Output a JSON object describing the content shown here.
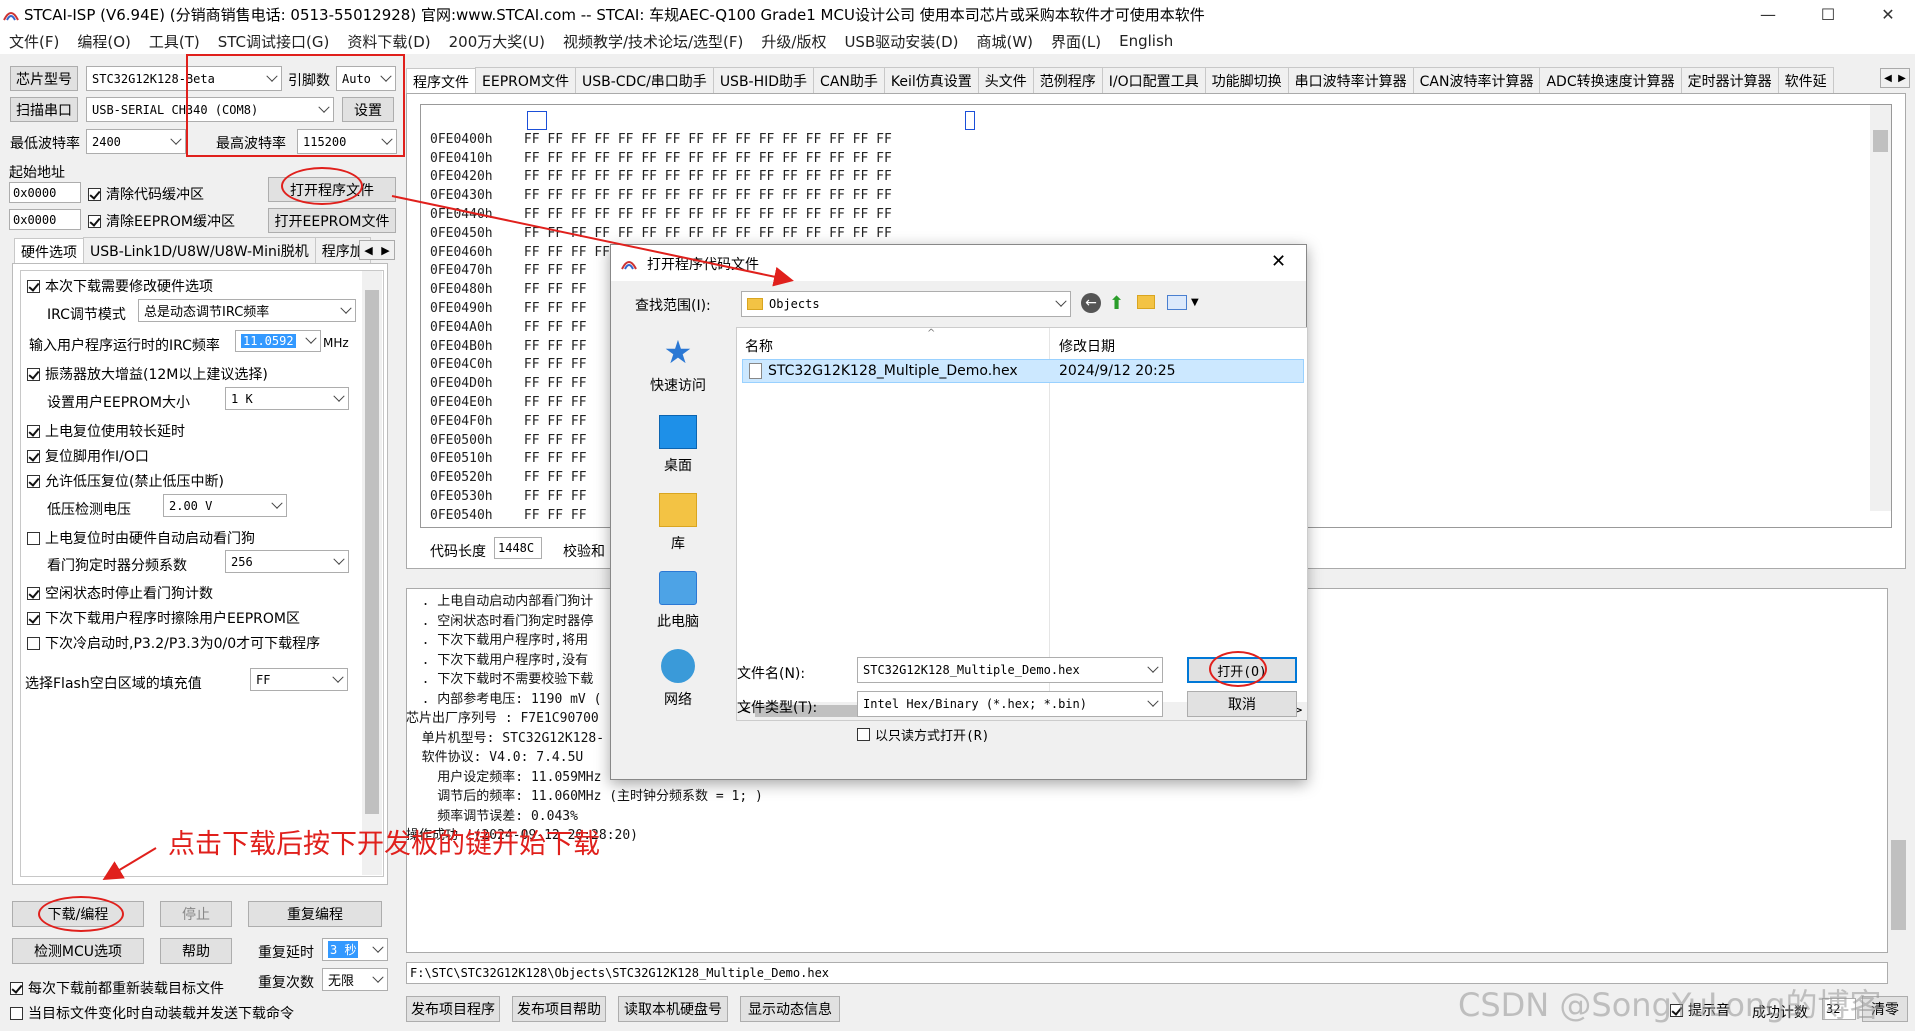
{
  "window": {
    "title": "STCAI-ISP (V6.94E) (分销商销售电话: 0513-55012928) 官网:www.STCAI.com  -- STCAI: 车规AEC-Q100 Grade1 MCU设计公司 使用本司芯片或采购本软件才可使用本软件",
    "min": "—",
    "max": "☐",
    "close": "✕"
  },
  "menu": [
    "文件(F)",
    "编程(O)",
    "工具(T)",
    "STC调试接口(G)",
    "资料下载(D)",
    "200万大奖(U)",
    "视频教学/技术论坛/选型(F)",
    "升级/版权",
    "USB驱动安装(D)",
    "商城(W)",
    "界面(L)",
    "English"
  ],
  "left": {
    "chip_type_btn": "芯片型号",
    "chip_type": "STC32G12K128-Beta",
    "pin_count_label": "引脚数",
    "pin_count": "Auto",
    "scan_port_btn": "扫描串口",
    "port": "USB-SERIAL CH340 (COM8)",
    "settings_btn": "设置",
    "min_baud_label": "最低波特率",
    "min_baud": "2400",
    "max_baud_label": "最高波特率",
    "max_baud": "115200",
    "start_addr_label": "起始地址",
    "addr1": "0x0000",
    "clear_code_buf": "清除代码缓冲区",
    "open_program_btn": "打开程序文件",
    "addr2": "0x0000",
    "clear_eeprom_buf": "清除EEPROM缓冲区",
    "open_eeprom_btn": "打开EEPROM文件",
    "tabs": [
      "硬件选项",
      "USB-Link1D/U8W/U8W-Mini脱机",
      "程序加"
    ],
    "hw": {
      "modify_hw": "本次下载需要修改硬件选项",
      "irc_mode_label": "IRC调节模式",
      "irc_mode": "总是动态调节IRC频率",
      "irc_freq_label": "输入用户程序运行时的IRC频率",
      "irc_freq": "11.0592",
      "mhz": "MHz",
      "osc_gain": "振荡器放大增益(12M以上建议选择)",
      "eeprom_size_label": "设置用户EEPROM大小",
      "eeprom_size": "1    K",
      "long_delay": "上电复位使用较长延时",
      "reset_io": "复位脚用作I/O口",
      "lvr": "允许低压复位(禁止低压中断)",
      "lvd_label": "低压检测电压",
      "lvd": "2.00 V",
      "wdt_auto": "上电复位时由硬件自动启动看门狗",
      "wdt_div_label": "看门狗定时器分频系数",
      "wdt_div": "256",
      "idle_wdt": "空闲状态时停止看门狗计数",
      "erase_eeprom": "下次下载用户程序时擦除用户EEPROM区",
      "p32p33": "下次冷启动时,P3.2/P3.3为0/0才可下载程序",
      "fill_label": "选择Flash空白区域的填充值",
      "fill": "FF"
    },
    "download_btn": "下载/编程",
    "stop_btn": "停止",
    "reprogram_btn": "重复编程",
    "check_mcu_btn": "检测MCU选项",
    "help_btn": "帮助",
    "repeat_delay_label": "重复延时",
    "repeat_delay": "3 秒",
    "repeat_count_label": "重复次数",
    "repeat_count": "无限",
    "reload_each": "每次下载前都重新装载目标文件",
    "auto_send": "当目标文件变化时自动装载并发送下载命令"
  },
  "right": {
    "tabs": [
      "程序文件",
      "EEPROM文件",
      "USB-CDC/串口助手",
      "USB-HID助手",
      "CAN助手",
      "Keil仿真设置",
      "头文件",
      "范例程序",
      "I/O口配置工具",
      "功能脚切换",
      "串口波特率计算器",
      "CAN波特率计算器",
      "ADC转换速度计算器",
      "定时器计算器",
      "软件延"
    ],
    "hex_rows": [
      "0FE0400h    FF FF FF FF FF FF FF FF FF FF FF FF FF FF FF FF",
      "0FE0410h    FF FF FF FF FF FF FF FF FF FF FF FF FF FF FF FF",
      "0FE0420h    FF FF FF FF FF FF FF FF FF FF FF FF FF FF FF FF",
      "0FE0430h    FF FF FF FF FF FF FF FF FF FF FF FF FF FF FF FF",
      "0FE0440h    FF FF FF FF FF FF FF FF FF FF FF FF FF FF FF FF",
      "0FE0450h    FF FF FF FF FF FF FF FF FF FF FF FF FF FF FF FF",
      "0FE0460h    FF FF FF FF FF FF FF FF FF FF FF FF FF FF FF FF",
      "0FE0470h    FF FF FF",
      "0FE0480h    FF FF FF",
      "0FE0490h    FF FF FF",
      "0FE04A0h    FF FF FF",
      "0FE04B0h    FF FF FF",
      "0FE04C0h    FF FF FF",
      "0FE04D0h    FF FF FF",
      "0FE04E0h    FF FF FF",
      "0FE04F0h    FF FF FF",
      "0FE0500h    FF FF FF",
      "0FE0510h    FF FF FF",
      "0FE0520h    FF FF FF",
      "0FE0530h    FF FF FF",
      "0FE0540h    FF FF FF"
    ],
    "code_len_label": "代码长度",
    "code_len": "1448C",
    "checksum_label": "校验和",
    "log_lines": [
      "  . 上电自动启动内部看门狗计",
      "  . 空闲状态时看门狗定时器停",
      "  . 下次下载用户程序时,将用",
      "  . 下次下载用户程序时,没有",
      "  . 下次下载时不需要校验下载",
      "  . 内部参考电压: 1190 mV (",
      "芯片出厂序列号 : F7E1C90700",
      "",
      "  单片机型号: STC32G12K128-",
      "  软件协议: V4.0: 7.4.5U",
      "",
      "    用户设定频率: 11.059MHz",
      "    调节后的频率: 11.060MHz (主时钟分频系数 = 1; )",
      "    频率调节误差: 0.043%",
      "",
      "",
      "操作成功 !(2024-09-12 20:28:20)"
    ],
    "path": "F:\\STC\\STC32G12K128\\Objects\\STC32G12K128_Multiple_Demo.hex",
    "publish_program": "发布项目程序",
    "publish_help": "发布项目帮助",
    "read_disk": "读取本机硬盘号",
    "show_info": "显示动态信息",
    "tip": "提示音",
    "success_count": "成功计数",
    "count": "32",
    "clear": "清零"
  },
  "dialog": {
    "title": "打开程序代码文件",
    "lookin_label": "查找范围(I):",
    "lookin": "Objects",
    "places": [
      "快速访问",
      "桌面",
      "库",
      "此电脑",
      "网络"
    ],
    "col_name": "名称",
    "col_date": "修改日期",
    "file_name": "STC32G12K128_Multiple_Demo.hex",
    "file_date": "2024/9/12 20:25",
    "filename_label": "文件名(N):",
    "filename": "STC32G12K128_Multiple_Demo.hex",
    "filetype_label": "文件类型(T):",
    "filetype": "Intel Hex/Binary (*.hex; *.bin)",
    "readonly": "以只读方式打开(R)",
    "open_btn": "打开(O)",
    "cancel_btn": "取消"
  },
  "annotation": "点击下载后按下开发板的键开始下载",
  "watermark": "CSDN @SongYuLong的博客",
  "colors": {
    "red": "#e0201c",
    "select": "#cce8ff",
    "highlight": "#3399ff"
  }
}
